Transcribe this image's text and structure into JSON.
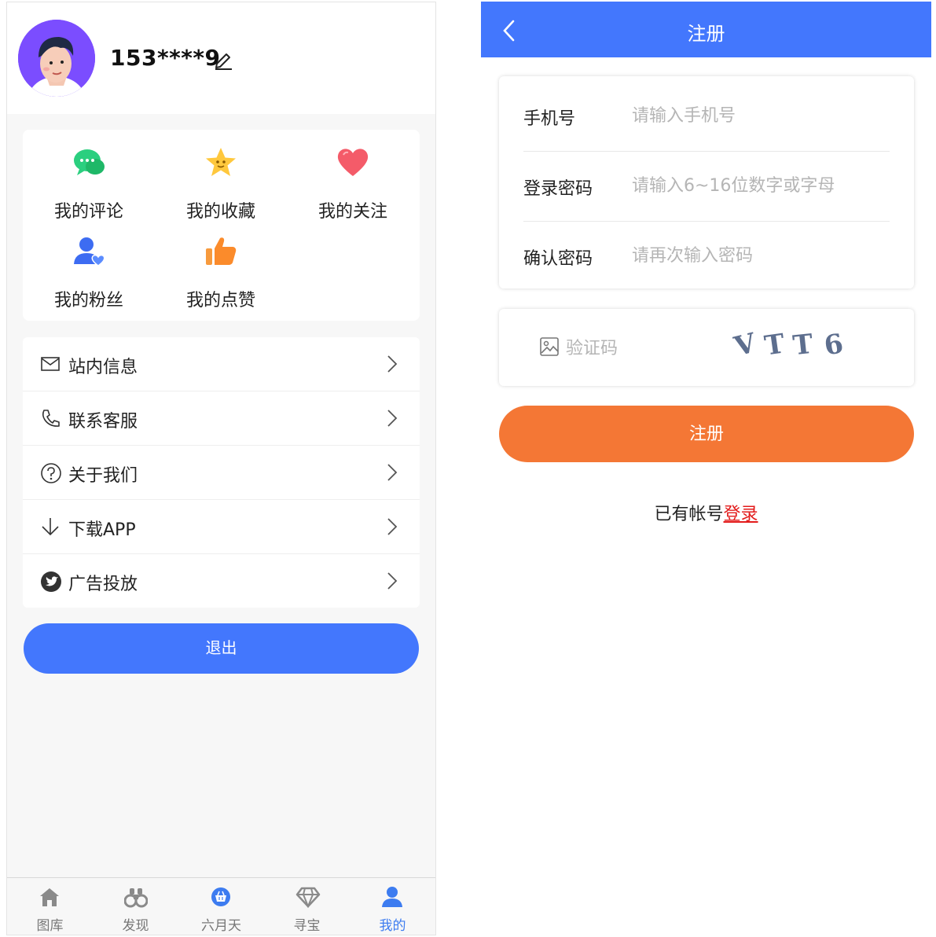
{
  "colors": {
    "primary_blue": "#4377fd",
    "orange": "#f47735",
    "active_tab": "#3d7cf0",
    "link_red": "#e31b1b"
  },
  "profile": {
    "username": "153****9",
    "edit_icon": "pencil-icon",
    "avatar_icon": "avatar-illustration"
  },
  "shortcuts": [
    {
      "label": "我的评论",
      "icon": "chat-bubbles-icon"
    },
    {
      "label": "我的收藏",
      "icon": "star-icon"
    },
    {
      "label": "我的关注",
      "icon": "heart-icon"
    },
    {
      "label": "我的粉丝",
      "icon": "user-heart-icon"
    },
    {
      "label": "我的点赞",
      "icon": "thumbs-up-icon"
    }
  ],
  "menu": [
    {
      "label": "站内信息",
      "icon": "mail-icon"
    },
    {
      "label": "联系客服",
      "icon": "phone-icon"
    },
    {
      "label": "关于我们",
      "icon": "question-circle-icon"
    },
    {
      "label": "下载APP",
      "icon": "download-arrow-icon"
    },
    {
      "label": "广告投放",
      "icon": "twitter-bird-icon"
    }
  ],
  "logout_label": "退出",
  "tabbar": [
    {
      "label": "图库",
      "icon": "home-icon",
      "active": false
    },
    {
      "label": "发现",
      "icon": "binoculars-icon",
      "active": false
    },
    {
      "label": "六月天",
      "icon": "basket-icon",
      "active": false
    },
    {
      "label": "寻宝",
      "icon": "diamond-icon",
      "active": false
    },
    {
      "label": "我的",
      "icon": "person-icon",
      "active": true
    }
  ],
  "register": {
    "title": "注册",
    "fields": [
      {
        "label": "手机号",
        "placeholder": "请输入手机号"
      },
      {
        "label": "登录密码",
        "placeholder": "请输入6~16位数字或字母"
      },
      {
        "label": "确认密码",
        "placeholder": "请再次输入密码"
      }
    ],
    "captcha_placeholder": "验证码",
    "captcha_text": [
      "V",
      "T",
      "T",
      "6"
    ],
    "submit_label": "注册",
    "have_account_text": "已有帐号",
    "login_link": "登录"
  }
}
